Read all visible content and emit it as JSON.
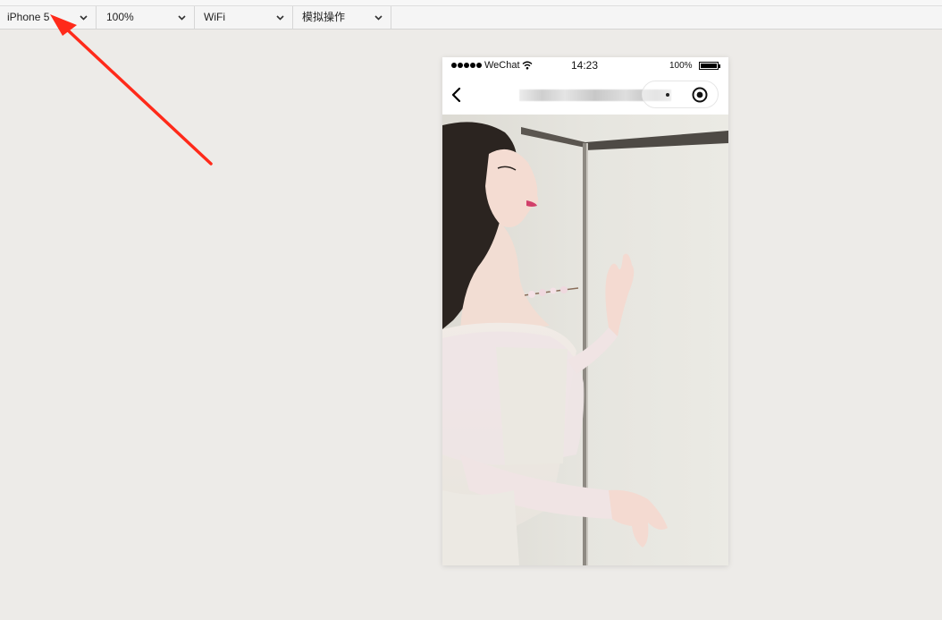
{
  "toolbar": {
    "device": "iPhone 5",
    "zoom": "100%",
    "network": "WiFi",
    "simulate": "模拟操作"
  },
  "status_bar": {
    "carrier": "WeChat",
    "time": "14:23",
    "battery": "100%"
  },
  "icons": {
    "back": "chevron-left-icon",
    "more": "more-icon",
    "close": "target-close-icon",
    "wifi": "wifi-icon",
    "battery": "battery-icon",
    "dropdown": "chevron-down-icon"
  },
  "colors": {
    "background": "#edebe8",
    "annotation_arrow": "#ff2a1a"
  }
}
